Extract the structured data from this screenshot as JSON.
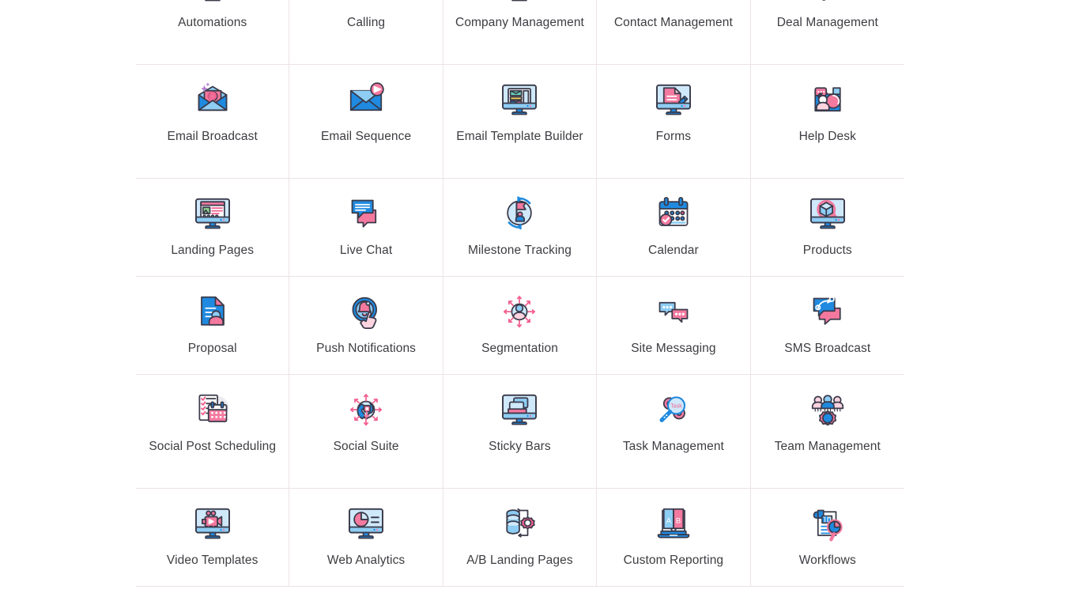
{
  "grid": {
    "columns": 5,
    "divider_color": "#ece2e6",
    "label_color": "#3d3d42",
    "palette": {
      "blue": "#1f8ae0",
      "light_blue": "#8ecdf4",
      "pale_blue": "#cfe9fb",
      "pink": "#f4799f",
      "hot_pink": "#f2608f",
      "pale_pink": "#fbd4e0",
      "outline": "#3a3a4a",
      "white": "#ffffff"
    },
    "items": [
      {
        "label": "Automations",
        "icon": "monitor-gears-icon",
        "row": 1
      },
      {
        "label": "Calling",
        "icon": "phone-receiver-icon",
        "row": 1
      },
      {
        "label": "Company Management",
        "icon": "monitor-two-people-icon",
        "row": 1
      },
      {
        "label": "Contact Management",
        "icon": "two-contacts-icon",
        "row": 1
      },
      {
        "label": "Deal Management",
        "icon": "handshake-icon",
        "row": 1
      },
      {
        "label": "Email Broadcast",
        "icon": "envelope-at-sparkle-icon",
        "row": 2
      },
      {
        "label": "Email Sequence",
        "icon": "envelope-send-icon",
        "row": 2
      },
      {
        "label": "Email Template Builder",
        "icon": "monitor-template-icon",
        "row": 2
      },
      {
        "label": "Forms",
        "icon": "monitor-form-pencil-icon",
        "row": 2
      },
      {
        "label": "Help Desk",
        "icon": "support-folder-icon",
        "row": 2
      },
      {
        "label": "Landing Pages",
        "icon": "monitor-webpage-icon",
        "row": 3
      },
      {
        "label": "Live Chat",
        "icon": "chat-bubbles-icon",
        "row": 3
      },
      {
        "label": "Milestone Tracking",
        "icon": "flag-cycle-icon",
        "row": 3
      },
      {
        "label": "Calendar",
        "icon": "calendar-check-icon",
        "row": 3
      },
      {
        "label": "Products",
        "icon": "monitor-cube-icon",
        "row": 3
      },
      {
        "label": "Proposal",
        "icon": "document-person-icon",
        "row": 4
      },
      {
        "label": "Push Notifications",
        "icon": "bell-tap-icon",
        "row": 4
      },
      {
        "label": "Segmentation",
        "icon": "user-arrows-icon",
        "row": 4
      },
      {
        "label": "Site Messaging",
        "icon": "two-chat-dots-icon",
        "row": 4
      },
      {
        "label": "SMS Broadcast",
        "icon": "sms-bubbles-icon",
        "row": 4
      },
      {
        "label": "Social Post Scheduling",
        "icon": "checklist-calendar-icon",
        "row": 5
      },
      {
        "label": "Social Suite",
        "icon": "globe-arrows-icon",
        "row": 5
      },
      {
        "label": "Sticky Bars",
        "icon": "monitor-sticky-bar-icon",
        "row": 5
      },
      {
        "label": "Task Management",
        "icon": "magnifier-task-gears-icon",
        "row": 5
      },
      {
        "label": "Team Management",
        "icon": "people-gear-icon",
        "row": 5
      },
      {
        "label": "Video Templates",
        "icon": "monitor-video-camera-icon",
        "row": 6
      },
      {
        "label": "Web Analytics",
        "icon": "monitor-pie-chart-icon",
        "row": 6
      },
      {
        "label": "A/B Landing Pages",
        "icon": "ab-flow-gear-icon",
        "row": 6
      },
      {
        "label": "Custom Reporting",
        "icon": "laptop-ab-book-icon",
        "row": 6
      },
      {
        "label": "Workflows",
        "icon": "scroll-chart-magnifier-icon",
        "row": 6
      }
    ]
  }
}
